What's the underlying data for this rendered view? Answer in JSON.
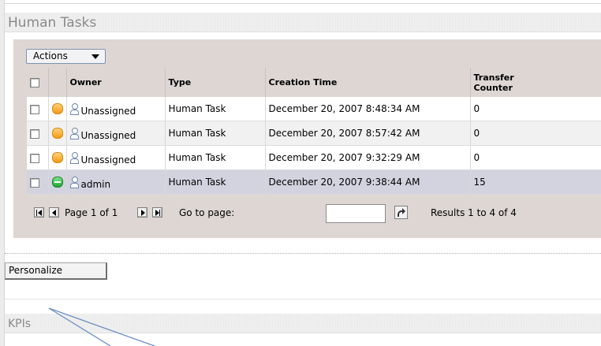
{
  "section": {
    "title": "Human Tasks"
  },
  "actions": {
    "label": "Actions"
  },
  "table": {
    "headers": {
      "owner": "Owner",
      "type": "Type",
      "creation_time": "Creation Time",
      "transfer_counter": "Transfer Counter"
    },
    "rows": [
      {
        "priority": "warning",
        "owner": "Unassigned",
        "type": "Human Task",
        "creation_time": "December 20, 2007 8:48:34 AM",
        "transfer_counter": "0"
      },
      {
        "priority": "warning",
        "owner": "Unassigned",
        "type": "Human Task",
        "creation_time": "December 20, 2007 8:57:42 AM",
        "transfer_counter": "0"
      },
      {
        "priority": "warning",
        "owner": "Unassigned",
        "type": "Human Task",
        "creation_time": "December 20, 2007 9:32:29 AM",
        "transfer_counter": "0"
      },
      {
        "priority": "normal",
        "owner": "admin",
        "type": "Human Task",
        "creation_time": "December 20, 2007 9:38:44 AM",
        "transfer_counter": "15"
      }
    ]
  },
  "pager": {
    "page_info": "Page 1 of 1",
    "goto_label": "Go to page:",
    "goto_value": "",
    "results": "Results 1 to 4 of 4"
  },
  "personalize": {
    "label": "Personalize"
  },
  "kpis": {
    "title": "KPIs"
  },
  "colors": {
    "panel_bg": "#ddd6d3",
    "selected_row": "#d3d3e0",
    "priority_warning": "#f59a16",
    "priority_normal": "#1fa630",
    "annotation_line": "#6a8fc0"
  }
}
